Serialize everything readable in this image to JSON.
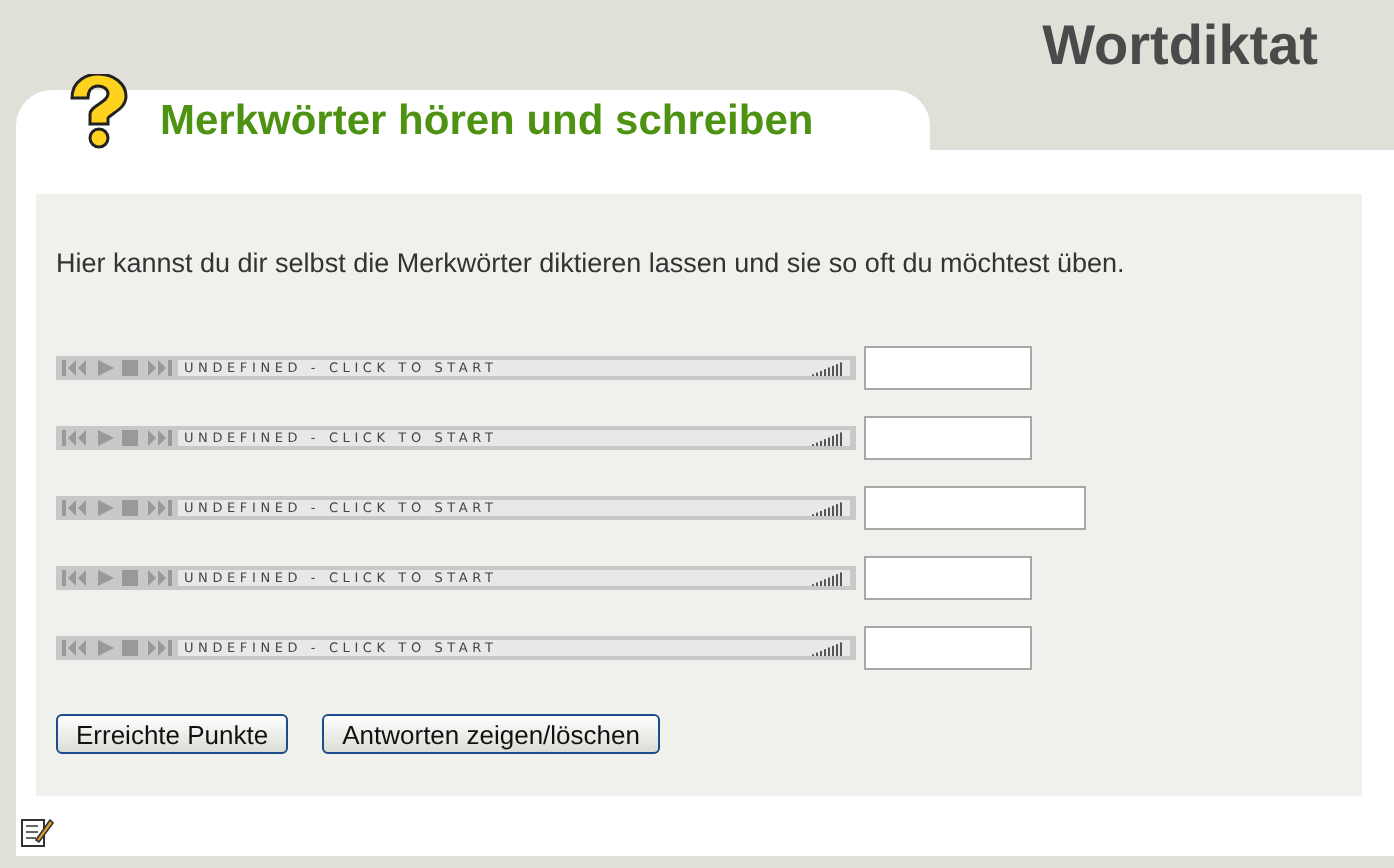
{
  "page_title": "Wortdiktat",
  "tab_title": "Merkwörter hören und schreiben",
  "intro": "Hier kannst du dir selbst die Merkwörter diktieren lassen und sie so oft du möchtest üben.",
  "items": [
    {
      "player_status": "UNDEFINED - CLICK TO START"
    },
    {
      "player_status": "UNDEFINED - CLICK TO START"
    },
    {
      "player_status": "UNDEFINED - CLICK TO START"
    },
    {
      "player_status": "UNDEFINED - CLICK TO START"
    },
    {
      "player_status": "UNDEFINED - CLICK TO START"
    }
  ],
  "buttons": [
    "Erreichte Punkte",
    "Antworten zeigen/löschen"
  ]
}
